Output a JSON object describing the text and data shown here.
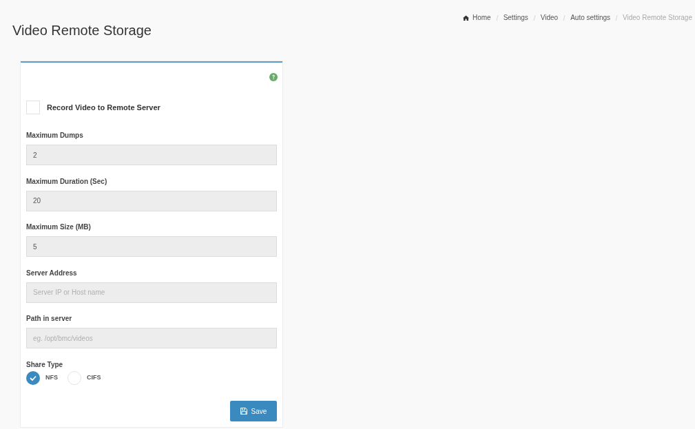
{
  "breadcrumb": [
    {
      "label": "Home",
      "kind": "home"
    },
    {
      "label": "Settings",
      "kind": "link"
    },
    {
      "label": "Video",
      "kind": "link"
    },
    {
      "label": "Auto settings",
      "kind": "link"
    },
    {
      "label": "Video Remote Storage",
      "kind": "current"
    }
  ],
  "page_title": "Video Remote Storage",
  "form": {
    "record_checkbox": {
      "label": "Record Video to Remote Server",
      "checked": false
    },
    "fields": [
      {
        "label": "Maximum Dumps",
        "value": "2",
        "disabled": true
      },
      {
        "label": "Maximum Duration (Sec)",
        "value": "20",
        "disabled": true
      },
      {
        "label": "Maximum Size (MB)",
        "value": "5",
        "disabled": true
      },
      {
        "label": "Server Address",
        "placeholder": "Server IP or Host name",
        "disabled": true
      },
      {
        "label": "Path in server",
        "placeholder": "eg. /opt/bmc/videos",
        "disabled": true
      }
    ],
    "share_type": {
      "label": "Share Type",
      "options": [
        {
          "label": "NFS",
          "selected": true
        },
        {
          "label": "CIFS",
          "selected": false
        }
      ]
    },
    "save_button": {
      "label": "Save"
    }
  }
}
